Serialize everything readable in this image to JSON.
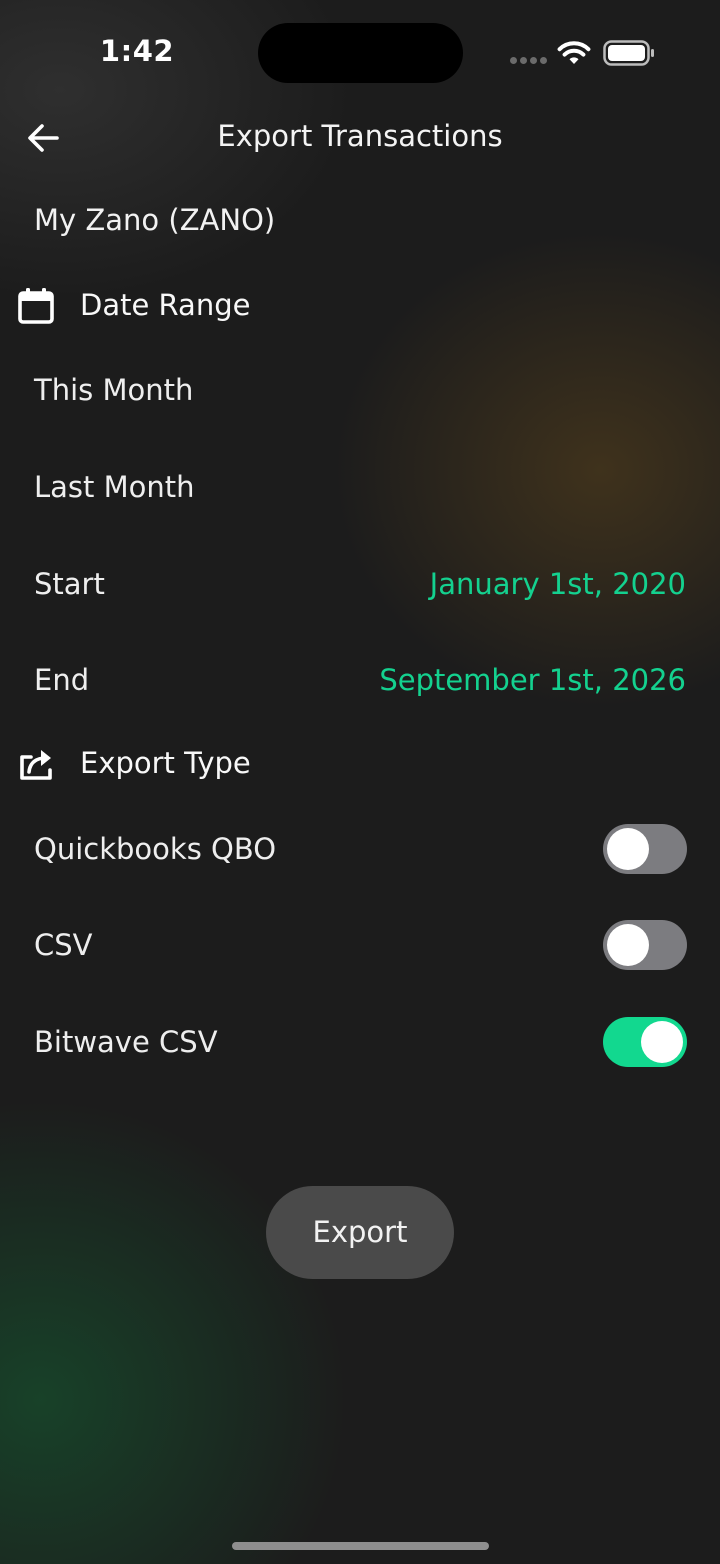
{
  "status_bar": {
    "time": "1:42"
  },
  "header": {
    "title": "Export Transactions",
    "back_icon": "arrow-left-icon"
  },
  "wallet": {
    "name": "My Zano (ZANO)"
  },
  "date_range": {
    "icon": "calendar-icon",
    "title": "Date Range",
    "presets": [
      {
        "label": "This Month"
      },
      {
        "label": "Last Month"
      }
    ],
    "start": {
      "label": "Start",
      "value": "January 1st, 2020"
    },
    "end": {
      "label": "End",
      "value": "September 1st, 2026"
    }
  },
  "export_type": {
    "icon": "share-icon",
    "title": "Export Type",
    "options": [
      {
        "label": "Quickbooks QBO",
        "enabled": false
      },
      {
        "label": "CSV",
        "enabled": false
      },
      {
        "label": "Bitwave CSV",
        "enabled": true
      }
    ]
  },
  "actions": {
    "export_label": "Export"
  },
  "colors": {
    "accent": "#14d18f",
    "background": "#1c1c1c",
    "toggle_off": "#7c7c80",
    "button": "#4a4a4a"
  }
}
